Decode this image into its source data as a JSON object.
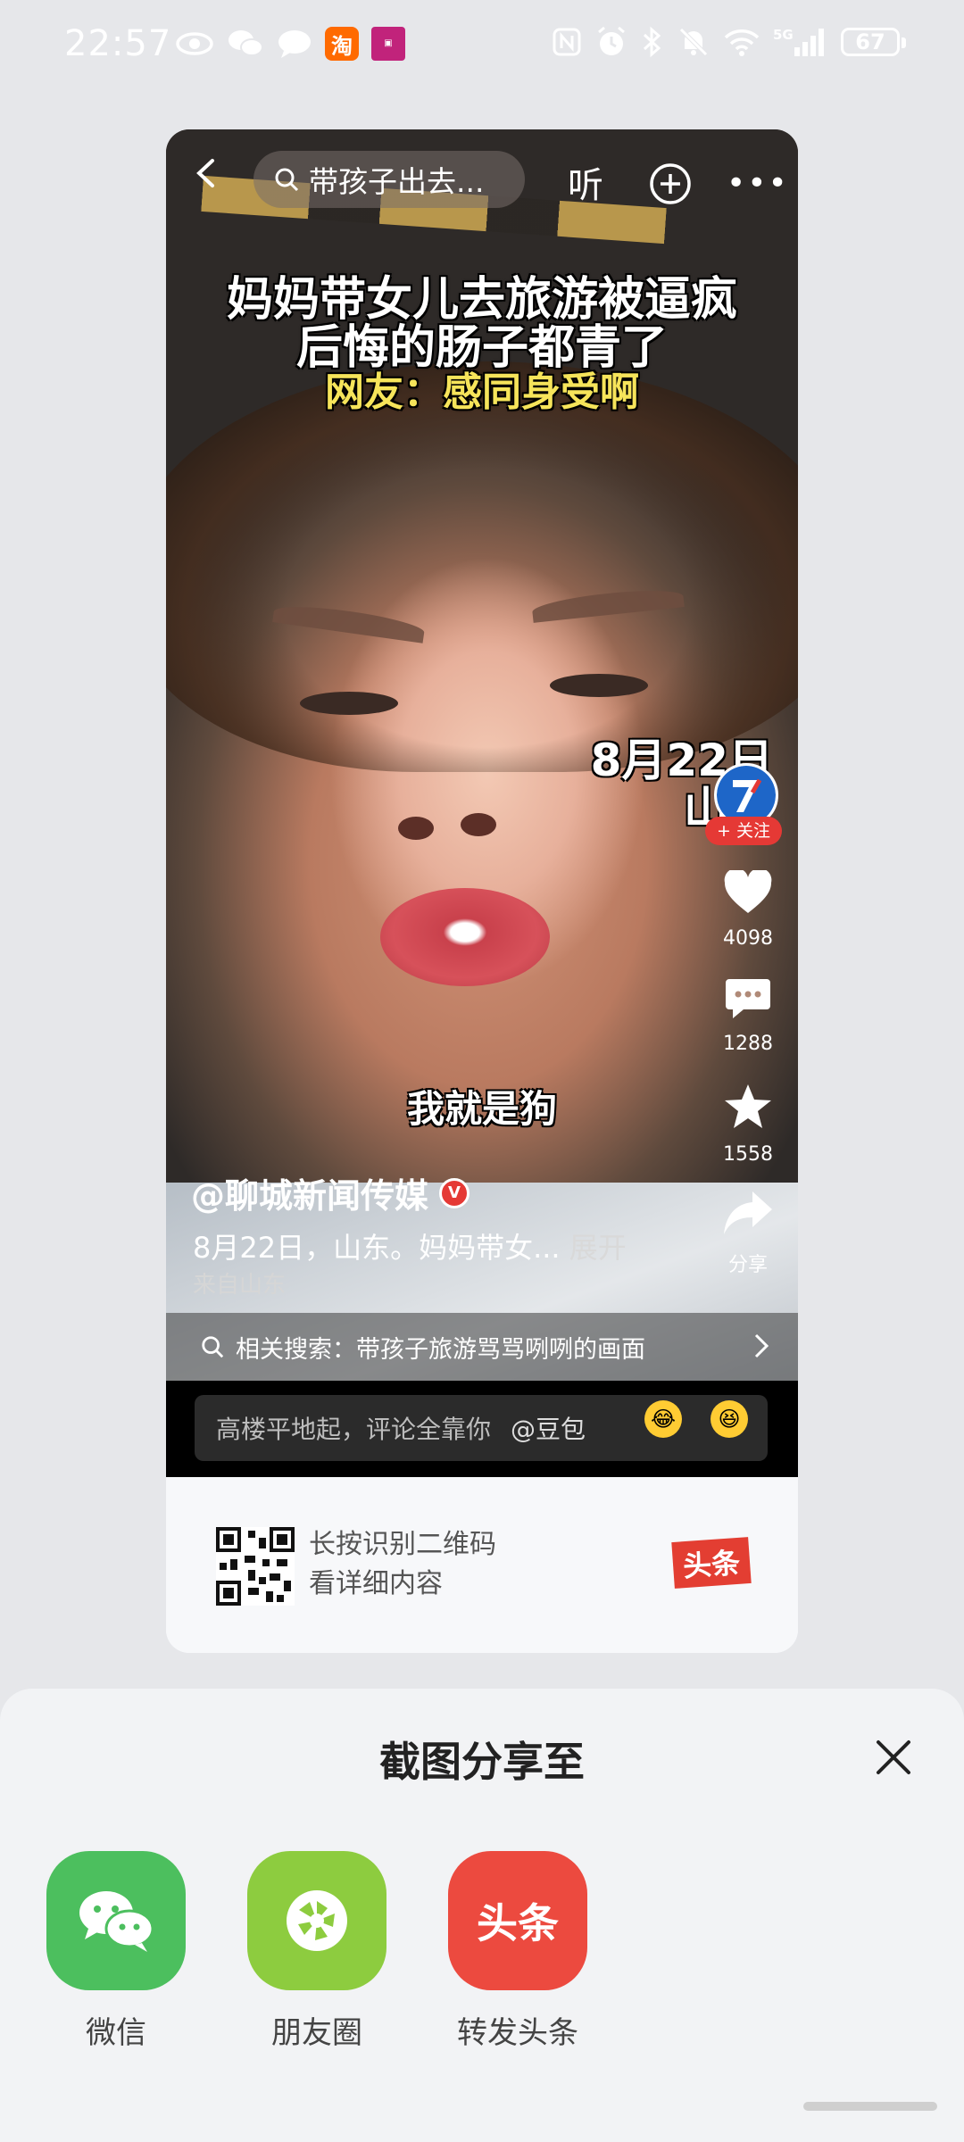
{
  "status_bar": {
    "time": "22:57",
    "battery": "67"
  },
  "video": {
    "search_text": "带孩子出去...",
    "listen_label": "听",
    "headline_1": "妈妈带女儿去旅游被逼疯",
    "headline_2": "后悔的肠子都青了",
    "headline_3": "网友：感同身受啊",
    "date_tag_1": "8月22日",
    "date_tag_2": "山东",
    "subtitle": "我就是狗",
    "follow_label": "+ 关注",
    "likes": "4098",
    "comments": "1288",
    "favorites": "1558",
    "share_label": "分享",
    "author": "@聊城新闻传媒",
    "description": "8月22日，山东。妈妈带女...",
    "expand_label": "展开",
    "from_text": "来自山东",
    "related_search": "相关搜索：带孩子旅游骂骂咧咧的画面",
    "comment_placeholder": "高楼平地起，评论全靠你",
    "comment_at": "@豆包"
  },
  "qr": {
    "line_1": "长按识别二维码",
    "line_2": "看详细内容",
    "logo_text": "头条"
  },
  "sheet": {
    "title": "截图分享至",
    "targets": [
      {
        "label": "微信",
        "color": "#4cbf5e"
      },
      {
        "label": "朋友圈",
        "color": "#8dcc3f"
      },
      {
        "label": "转发头条",
        "color": "#ec4a3f",
        "icon_text": "头条"
      }
    ]
  }
}
